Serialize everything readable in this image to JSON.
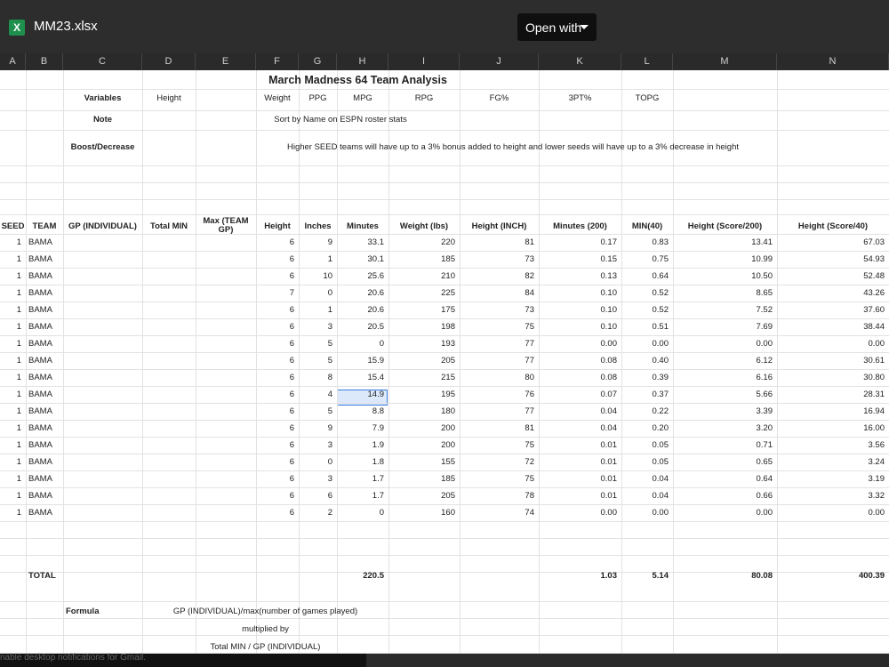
{
  "app": {
    "file_name": "MM23.xlsx",
    "icon_letter": "X",
    "open_with_label": "Open with"
  },
  "columns": [
    "A",
    "B",
    "C",
    "D",
    "E",
    "F",
    "G",
    "H",
    "I",
    "J",
    "K",
    "L",
    "M",
    "N"
  ],
  "sheet": {
    "title": "March Madness 64 Team Analysis",
    "variables_label": "Variables",
    "variables": [
      "Height",
      "Weight",
      "PPG",
      "MPG",
      "RPG",
      "FG%",
      "3PT%",
      "TOPG"
    ],
    "note_label": "Note",
    "note_text": "Sort by Name on ESPN roster stats",
    "boost_label": "Boost/Decrease",
    "boost_text": "Higher SEED teams will have up to a 3% bonus added to height and lower seeds will have up to a 3% decrease in height",
    "headers": [
      "SEED",
      "TEAM",
      "GP (INDIVIDUAL)",
      "Total MIN",
      "Max (TEAM GP)",
      "Height",
      "Inches",
      "Minutes",
      "Weight (lbs)",
      "Height (INCH)",
      "Minutes (200)",
      "MIN(40)",
      "Height (Score/200)",
      "Height (Score/40)"
    ],
    "rows": [
      [
        "1",
        "BAMA",
        "6",
        "9",
        "33.1",
        "220",
        "81",
        "0.17",
        "0.83",
        "13.41",
        "67.03"
      ],
      [
        "1",
        "BAMA",
        "6",
        "1",
        "30.1",
        "185",
        "73",
        "0.15",
        "0.75",
        "10.99",
        "54.93"
      ],
      [
        "1",
        "BAMA",
        "6",
        "10",
        "25.6",
        "210",
        "82",
        "0.13",
        "0.64",
        "10.50",
        "52.48"
      ],
      [
        "1",
        "BAMA",
        "7",
        "0",
        "20.6",
        "225",
        "84",
        "0.10",
        "0.52",
        "8.65",
        "43.26"
      ],
      [
        "1",
        "BAMA",
        "6",
        "1",
        "20.6",
        "175",
        "73",
        "0.10",
        "0.52",
        "7.52",
        "37.60"
      ],
      [
        "1",
        "BAMA",
        "6",
        "3",
        "20.5",
        "198",
        "75",
        "0.10",
        "0.51",
        "7.69",
        "38.44"
      ],
      [
        "1",
        "BAMA",
        "6",
        "5",
        "0",
        "193",
        "77",
        "0.00",
        "0.00",
        "0.00",
        "0.00"
      ],
      [
        "1",
        "BAMA",
        "6",
        "5",
        "15.9",
        "205",
        "77",
        "0.08",
        "0.40",
        "6.12",
        "30.61"
      ],
      [
        "1",
        "BAMA",
        "6",
        "8",
        "15.4",
        "215",
        "80",
        "0.08",
        "0.39",
        "6.16",
        "30.80"
      ],
      [
        "1",
        "BAMA",
        "6",
        "4",
        "14.9",
        "195",
        "76",
        "0.07",
        "0.37",
        "5.66",
        "28.31"
      ],
      [
        "1",
        "BAMA",
        "6",
        "5",
        "8.8",
        "180",
        "77",
        "0.04",
        "0.22",
        "3.39",
        "16.94"
      ],
      [
        "1",
        "BAMA",
        "6",
        "9",
        "7.9",
        "200",
        "81",
        "0.04",
        "0.20",
        "3.20",
        "16.00"
      ],
      [
        "1",
        "BAMA",
        "6",
        "3",
        "1.9",
        "200",
        "75",
        "0.01",
        "0.05",
        "0.71",
        "3.56"
      ],
      [
        "1",
        "BAMA",
        "6",
        "0",
        "1.8",
        "155",
        "72",
        "0.01",
        "0.05",
        "0.65",
        "3.24"
      ],
      [
        "1",
        "BAMA",
        "6",
        "3",
        "1.7",
        "185",
        "75",
        "0.01",
        "0.04",
        "0.64",
        "3.19"
      ],
      [
        "1",
        "BAMA",
        "6",
        "6",
        "1.7",
        "205",
        "78",
        "0.01",
        "0.04",
        "0.66",
        "3.32"
      ],
      [
        "1",
        "BAMA",
        "6",
        "2",
        "0",
        "160",
        "74",
        "0.00",
        "0.00",
        "0.00",
        "0.00"
      ]
    ],
    "total": {
      "label": "TOTAL",
      "minutes": "220.5",
      "minutes200": "1.03",
      "min40": "5.14",
      "score200": "80.08",
      "score40": "400.39"
    },
    "formula_label": "Formula",
    "formula_lines": [
      "GP (INDIVIDUAL)/max(number of games played)",
      "multiplied by",
      "Total MIN / GP (INDIVIDUAL)"
    ]
  },
  "toast_text": "nable desktop notifications for Gmail."
}
